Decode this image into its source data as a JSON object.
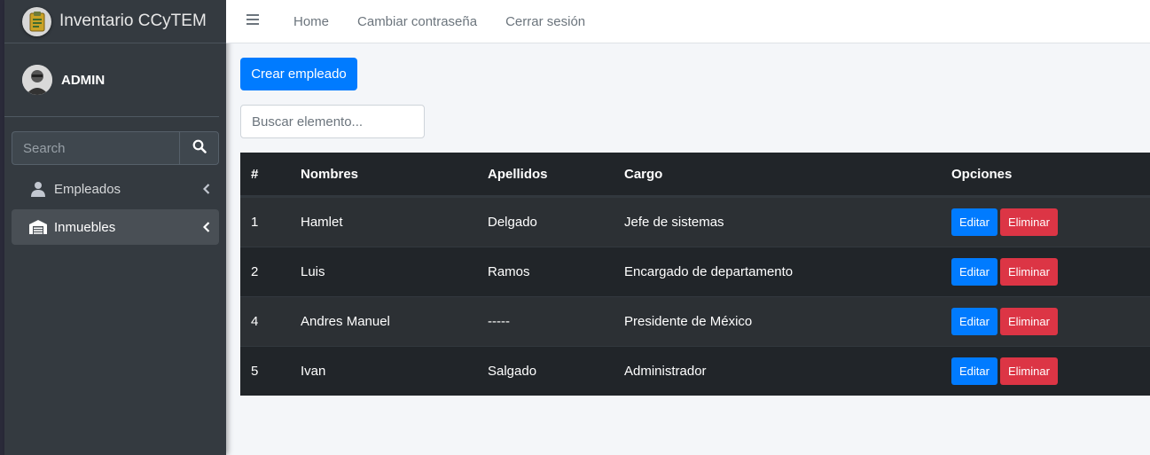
{
  "brand": {
    "title": "Inventario CCyTEM",
    "logo_icon": "clipboard-icon"
  },
  "user": {
    "name": "ADMIN",
    "avatar_icon": "user-avatar"
  },
  "sidebar": {
    "search_placeholder": "Search",
    "items": [
      {
        "label": "Empleados",
        "icon": "user-icon",
        "active": false
      },
      {
        "label": "Inmuebles",
        "icon": "warehouse-icon",
        "active": true
      }
    ]
  },
  "topnav": {
    "links": [
      "Home",
      "Cambiar contraseña",
      "Cerrar sesión"
    ]
  },
  "main": {
    "create_label": "Crear empleado",
    "search_placeholder": "Buscar elemento...",
    "table": {
      "headers": [
        "#",
        "Nombres",
        "Apellidos",
        "Cargo",
        "Opciones"
      ],
      "rows": [
        {
          "id": "1",
          "nombres": "Hamlet",
          "apellidos": "Delgado",
          "cargo": "Jefe de sistemas"
        },
        {
          "id": "2",
          "nombres": "Luis",
          "apellidos": "Ramos",
          "cargo": "Encargado de departamento"
        },
        {
          "id": "4",
          "nombres": "Andres Manuel",
          "apellidos": "-----",
          "cargo": "Presidente de México"
        },
        {
          "id": "5",
          "nombres": "Ivan",
          "apellidos": "Salgado",
          "cargo": "Administrador"
        }
      ],
      "edit_label": "Editar",
      "delete_label": "Eliminar"
    }
  },
  "colors": {
    "sidebar_bg": "#343a40",
    "primary": "#007bff",
    "danger": "#dc3545",
    "table_dark": "#212529"
  }
}
